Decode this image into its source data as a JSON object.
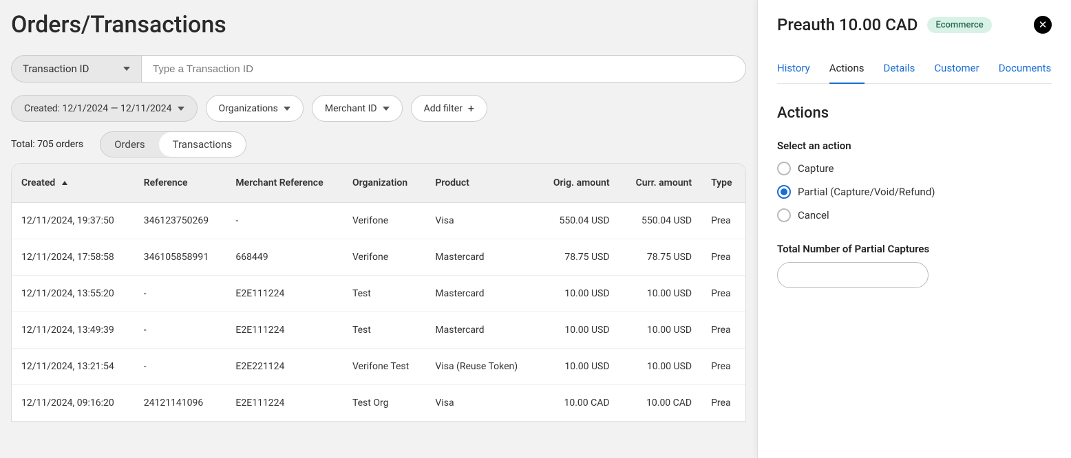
{
  "page_title": "Orders/Transactions",
  "search": {
    "select_label": "Transaction ID",
    "placeholder": "Type a Transaction ID"
  },
  "filters": {
    "date_label": "Created: 12/1/2024 — 12/11/2024",
    "organizations_label": "Organizations",
    "merchant_label": "Merchant ID",
    "add_filter_label": "Add filter"
  },
  "total_text": "Total: 705 orders",
  "view_tabs": {
    "orders": "Orders",
    "transactions": "Transactions"
  },
  "columns": {
    "created": "Created",
    "reference": "Reference",
    "merchant_reference": "Merchant Reference",
    "organization": "Organization",
    "product": "Product",
    "orig_amount": "Orig. amount",
    "curr_amount": "Curr. amount",
    "type": "Type"
  },
  "rows": [
    {
      "created": "12/11/2024, 19:37:50",
      "reference": "346123750269",
      "merchant_reference": "-",
      "organization": "Verifone",
      "product": "Visa",
      "orig_amount": "550.04 USD",
      "curr_amount": "550.04 USD",
      "type": "Prea"
    },
    {
      "created": "12/11/2024, 17:58:58",
      "reference": "346105858991",
      "merchant_reference": "668449",
      "organization": "Verifone",
      "product": "Mastercard",
      "orig_amount": "78.75 USD",
      "curr_amount": "78.75 USD",
      "type": "Prea"
    },
    {
      "created": "12/11/2024, 13:55:20",
      "reference": "-",
      "merchant_reference": "E2E111224",
      "organization": "Test",
      "product": "Mastercard",
      "orig_amount": "10.00 USD",
      "curr_amount": "10.00 USD",
      "type": "Prea"
    },
    {
      "created": "12/11/2024, 13:49:39",
      "reference": "-",
      "merchant_reference": "E2E111224",
      "organization": "Test",
      "product": "Mastercard",
      "orig_amount": "10.00 USD",
      "curr_amount": "10.00 USD",
      "type": "Prea"
    },
    {
      "created": "12/11/2024, 13:21:54",
      "reference": "-",
      "merchant_reference": "E2E221124",
      "organization": "Verifone Test",
      "product": "Visa (Reuse Token)",
      "orig_amount": "10.00 USD",
      "curr_amount": "10.00 USD",
      "type": "Prea"
    },
    {
      "created": "12/11/2024, 09:16:20",
      "reference": "24121141096",
      "merchant_reference": "E2E111224",
      "organization": "Test Org",
      "product": "Visa",
      "orig_amount": "10.00 CAD",
      "curr_amount": "10.00 CAD",
      "type": "Prea"
    }
  ],
  "panel": {
    "title": "Preauth 10.00 CAD",
    "badge": "Ecommerce",
    "tabs": {
      "history": "History",
      "actions": "Actions",
      "details": "Details",
      "customer": "Customer",
      "documents": "Documents"
    },
    "section_heading": "Actions",
    "select_action_label": "Select an action",
    "options": {
      "capture": "Capture",
      "partial": "Partial (Capture/Void/Refund)",
      "cancel": "Cancel"
    },
    "partial_field_label": "Total Number of Partial Captures",
    "partial_value": ""
  }
}
